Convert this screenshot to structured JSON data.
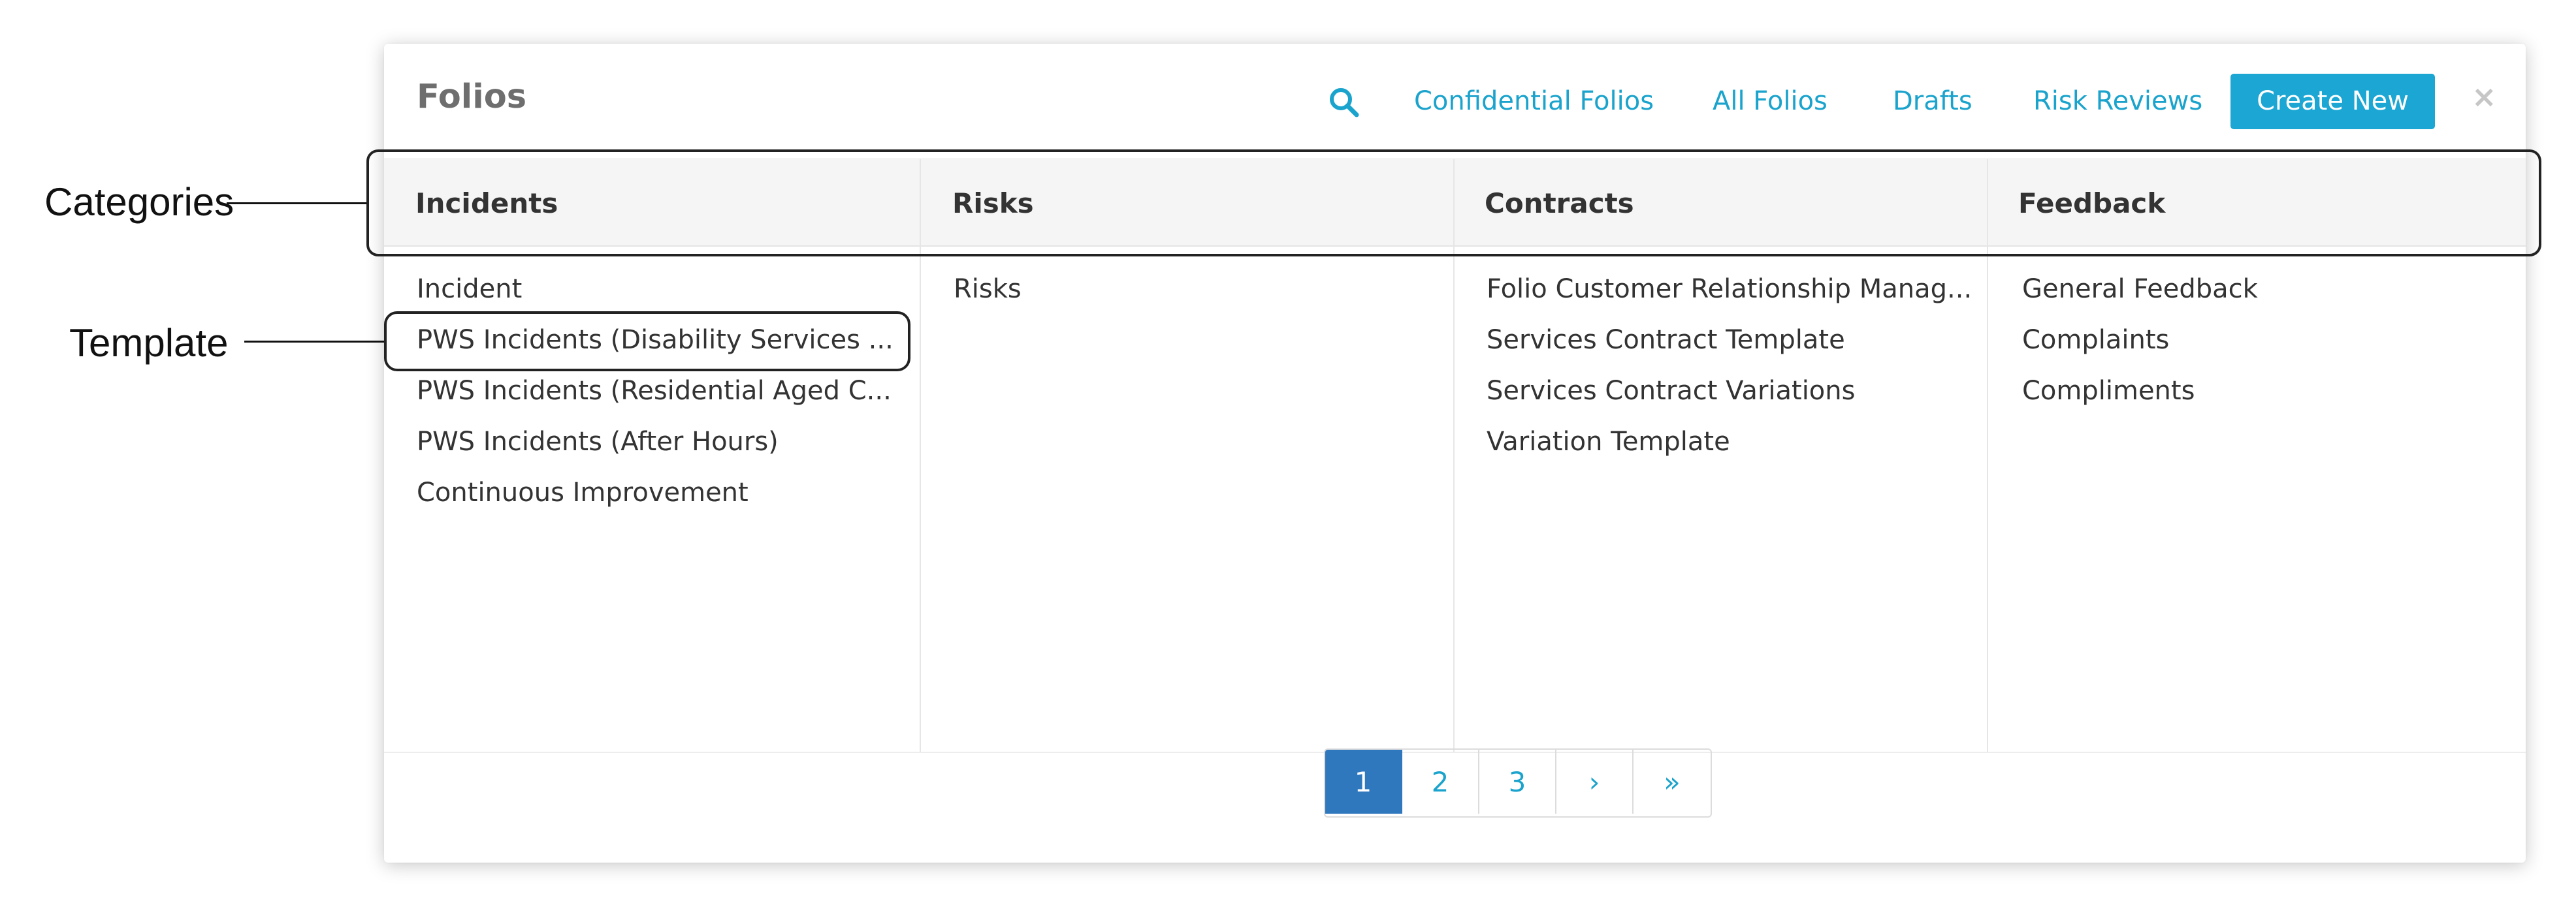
{
  "modal": {
    "title": "Folios",
    "nav": {
      "search_icon": "search-icon",
      "links": [
        "Confidential Folios",
        "All Folios",
        "Drafts",
        "Risk Reviews"
      ],
      "create_label": "Create New",
      "close_label": "×"
    },
    "columns": [
      {
        "header": "Incidents",
        "items": [
          "Incident",
          "PWS Incidents (Disability Services ...",
          "PWS Incidents (Residential Aged C...",
          "PWS Incidents (After Hours)",
          "Continuous Improvement"
        ]
      },
      {
        "header": "Risks",
        "items": [
          "Risks"
        ]
      },
      {
        "header": "Contracts",
        "items": [
          "Folio Customer Relationship Manag...",
          "Services Contract Template",
          "Services Contract Variations",
          "Variation Template"
        ]
      },
      {
        "header": "Feedback",
        "items": [
          "General Feedback",
          "Complaints",
          "Compliments"
        ]
      }
    ],
    "pagination": {
      "pages": [
        "1",
        "2",
        "3",
        "›",
        "»"
      ],
      "active": "1"
    }
  },
  "annotations": {
    "categories_label": "Categories",
    "template_label": "Template"
  },
  "colors": {
    "accent": "#1aa3cc",
    "primary_button": "#1ba6d3",
    "active_page": "#3078be",
    "header_bg": "#f5f5f5"
  }
}
